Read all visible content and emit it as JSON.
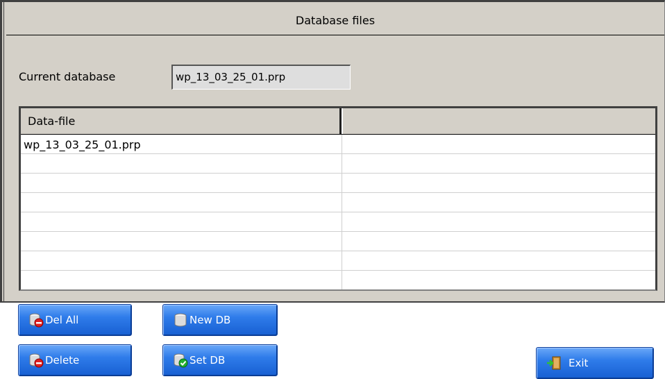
{
  "window": {
    "title": "Database files"
  },
  "current_database": {
    "label": "Current database",
    "value": "wp_13_03_25_01.prp"
  },
  "table": {
    "columns": [
      "Data-file",
      ""
    ],
    "rows": [
      [
        "wp_13_03_25_01.prp",
        ""
      ],
      [
        "",
        ""
      ],
      [
        "",
        ""
      ],
      [
        "",
        ""
      ],
      [
        "",
        ""
      ],
      [
        "",
        ""
      ],
      [
        "",
        ""
      ],
      [
        "",
        ""
      ]
    ]
  },
  "buttons": {
    "del_all": "Del All",
    "new_db": "New DB",
    "delete": "Delete",
    "set_db": "Set DB",
    "exit": "Exit"
  },
  "colors": {
    "button_blue": "#2f7cea",
    "panel_gray": "#d4d0c8",
    "danger_red": "#e02020",
    "ok_green": "#20b030"
  },
  "icons": {
    "del_all": "database-delete-icon",
    "new_db": "database-icon",
    "delete": "database-delete-icon",
    "set_db": "database-check-icon",
    "exit": "exit-door-icon"
  }
}
